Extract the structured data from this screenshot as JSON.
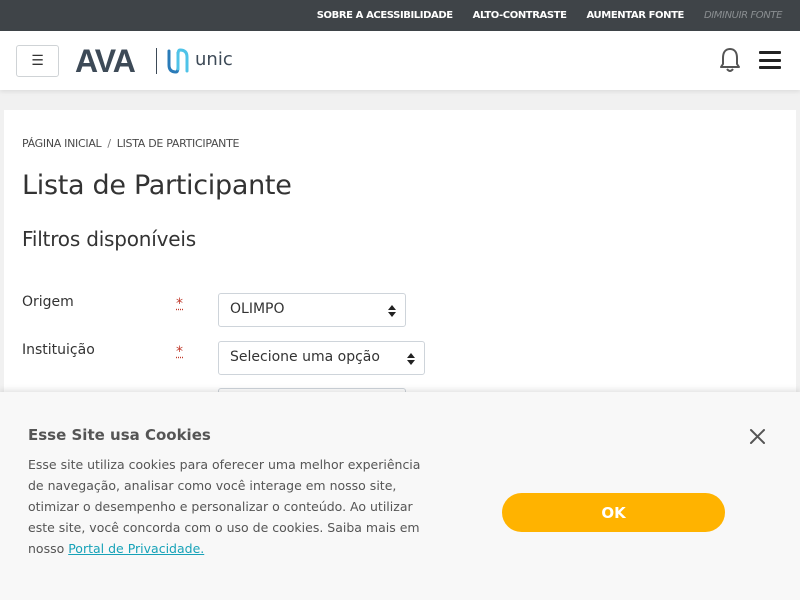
{
  "accessibility_bar": {
    "items": [
      "SOBRE A ACESSIBILIDADE",
      "ALTO-CONTRASTE",
      "AUMENTAR FONTE",
      "DIMINUIR FONTE"
    ]
  },
  "navbar": {
    "drawer_icon": "☰",
    "logo_text": "AVA",
    "logo_sub": "unic",
    "notification_icon": "bell-icon",
    "menu_icon": "hamburger-icon"
  },
  "breadcrumb": {
    "home": "PÁGINA INICIAL",
    "separator": "/",
    "current": "LISTA DE PARTICIPANTE"
  },
  "page": {
    "title": "Lista de Participante",
    "section_title": "Filtros disponíveis"
  },
  "filters": [
    {
      "label": "Origem",
      "required_mark": "*",
      "value": "OLIMPO"
    },
    {
      "label": "Instituição",
      "required_mark": "*",
      "value": "Selecione uma opção"
    }
  ],
  "cookie_banner": {
    "title": "Esse Site usa Cookies",
    "text": "Esse site utiliza cookies para oferecer uma melhor experiência de navegação, analisar como você interage em nosso site, otimizar o desempenho e personalizar o conteúdo. Ao utilizar este site, você concorda com o uso de cookies. Saiba mais em nosso ",
    "link_text": "Portal de Privacidade.",
    "ok_label": "OK",
    "close_icon": "close-icon"
  },
  "colors": {
    "top_bar": "#3f4448",
    "accent": "#ffb300",
    "link": "#17a2b8",
    "logo": "#3d4a57",
    "required": "#c0392b"
  }
}
